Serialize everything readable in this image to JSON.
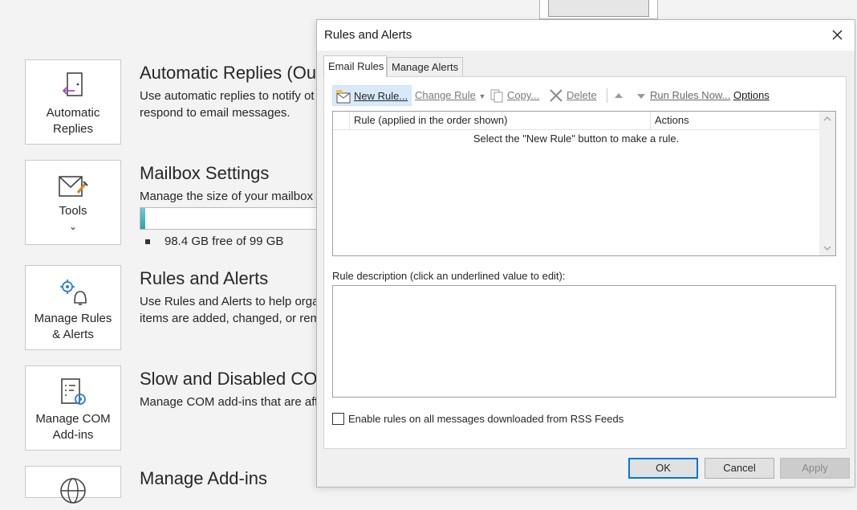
{
  "backstage": {
    "tiles": [
      {
        "label": "Automatic\nReplies",
        "icon": "automatic-replies-icon"
      },
      {
        "label": "Tools",
        "icon": "mail-tools-icon"
      },
      {
        "label": "Manage Rules\n& Alerts",
        "icon": "rules-alerts-icon"
      },
      {
        "label": "Manage COM\nAdd-ins",
        "icon": "com-addins-icon"
      },
      {
        "label": "",
        "icon": "globe-icon"
      }
    ],
    "sections": [
      {
        "title": "Automatic Replies (Out",
        "desc": "Use automatic replies to notify ot\nrespond to email messages."
      },
      {
        "title": "Mailbox Settings",
        "desc": "Manage the size of your mailbox"
      },
      {
        "title": "Rules and Alerts",
        "desc": "Use Rules and Alerts to help orga\nitems are added, changed, or rem"
      },
      {
        "title": "Slow and Disabled CON",
        "desc": "Manage COM add-ins that are aff"
      },
      {
        "title": "Manage Add-ins",
        "desc": ""
      }
    ],
    "mailbox": {
      "free_text": "98.4 GB free of 99 GB",
      "used_fraction": 0.006
    }
  },
  "dialog": {
    "title": "Rules and Alerts",
    "tabs": [
      "Email Rules",
      "Manage Alerts"
    ],
    "toolbar": {
      "new_rule": "New Rule...",
      "change_rule": "Change Rule",
      "copy": "Copy...",
      "delete": "Delete",
      "run_rules_now": "Run Rules Now...",
      "options": "Options"
    },
    "columns": [
      "Rule (applied in the order shown)",
      "Actions"
    ],
    "empty_message": "Select the \"New Rule\" button to make a rule.",
    "description_label": "Rule description (click an underlined value to edit):",
    "rss_checkbox": "Enable rules on all messages downloaded from RSS Feeds",
    "buttons": {
      "ok": "OK",
      "cancel": "Cancel",
      "apply": "Apply"
    }
  },
  "colors": {
    "accent": "#0078d7",
    "quota_fill": "#2aa3b6",
    "selected_toolbar": "#d8eafa"
  }
}
